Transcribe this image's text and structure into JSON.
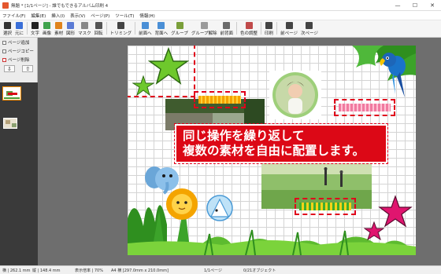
{
  "window": {
    "title": "無題 * [1/1ページ] - 誰でもできるアルバム印刷 4",
    "minimize": "—",
    "maximize": "☐",
    "close": "✕"
  },
  "menu": [
    "ファイル(F)",
    "編集(E)",
    "挿入(I)",
    "表示(V)",
    "ページ(P)",
    "ツール(T)",
    "情報(H)"
  ],
  "toolbar": [
    {
      "label": "選択",
      "icon": "pointer-icon",
      "color": "#333333"
    },
    {
      "label": "元に",
      "icon": "undo-icon",
      "color": "#3a6fd8"
    },
    {
      "label": "文字",
      "icon": "text-icon",
      "color": "#222222"
    },
    {
      "label": "画像",
      "icon": "image-icon",
      "color": "#3fa34d"
    },
    {
      "label": "素材",
      "icon": "clipart-icon",
      "color": "#e0841c"
    },
    {
      "label": "図形",
      "icon": "shape-icon",
      "color": "#5b7bd5"
    },
    {
      "label": "マスク",
      "icon": "mask-icon",
      "color": "#888888"
    },
    {
      "label": "回転",
      "icon": "rotate-icon",
      "color": "#555555"
    },
    {
      "label": "トリミング",
      "icon": "crop-icon",
      "color": "#444444"
    },
    {
      "label": "前面へ",
      "icon": "bring-front-icon",
      "color": "#4a8fd6"
    },
    {
      "label": "背面へ",
      "icon": "send-back-icon",
      "color": "#4a8fd6"
    },
    {
      "label": "グループ",
      "icon": "group-icon",
      "color": "#7a9f3a"
    },
    {
      "label": "グループ解除",
      "icon": "ungroup-icon",
      "color": "#9a9a9a"
    },
    {
      "label": "前背面",
      "icon": "layer-icon",
      "color": "#6a6a6a"
    },
    {
      "label": "色の調整",
      "icon": "color-adjust-icon",
      "color": "#c04a4a"
    },
    {
      "label": "印刷",
      "icon": "print-icon",
      "color": "#444444"
    },
    {
      "label": "前ページ",
      "icon": "prev-page-icon",
      "color": "#444444"
    },
    {
      "label": "次ページ",
      "icon": "next-page-icon",
      "color": "#444444"
    }
  ],
  "left_panel": {
    "add_page": "ページ追加",
    "copy_page": "ページコピー",
    "delete_page": "ページ削除",
    "down_arrow": "⇩",
    "up_arrow": "⇧"
  },
  "canvas": {
    "caption_line1": "同じ操作を繰り返して",
    "caption_line2": "複数の素材を自由に配置します。",
    "highlight_color": "#e0001b"
  },
  "status": {
    "width": "横 | 262.1 mm",
    "height": "縦 | 148.4 mm",
    "zoom": "表示倍率 | 70%",
    "paper": "A4 横 [297.0mm x 210.0mm]",
    "page": "1/1ページ",
    "objects": "0/21オブジェクト"
  }
}
